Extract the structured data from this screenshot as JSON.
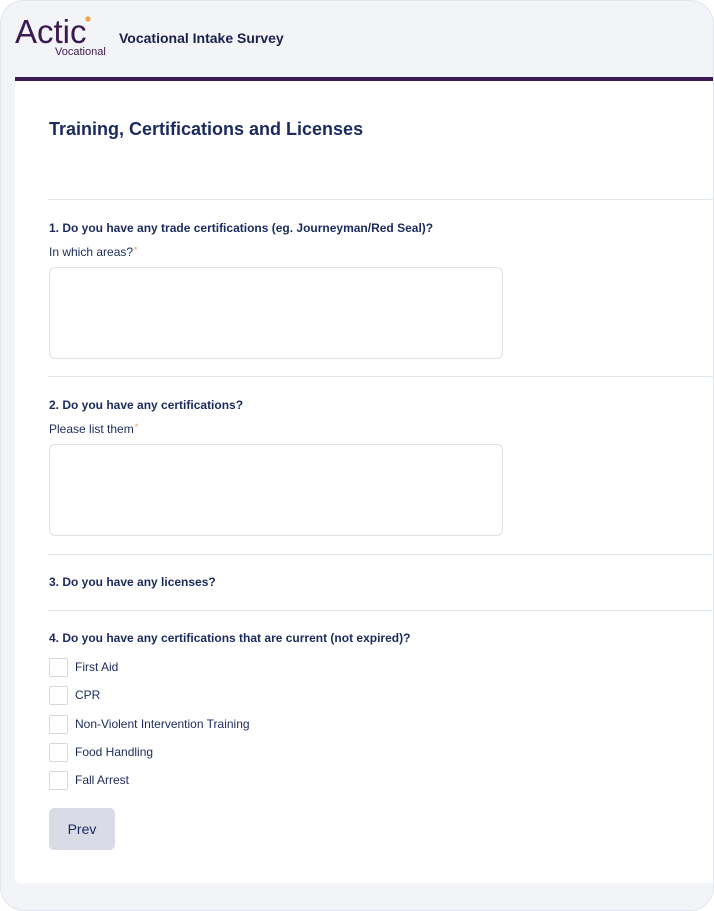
{
  "header": {
    "logo_text": "Actic",
    "logo_subtext": "Vocational",
    "title": "Vocational Intake Survey"
  },
  "colors": {
    "brand": "#3b1a50",
    "accent_dot": "#f0a44a",
    "text": "#1b2a5e"
  },
  "section": {
    "title": "Training, Certifications and Licenses"
  },
  "questions": [
    {
      "title": "1. Do you have any trade certifications (eg. Journeyman/Red Seal)?",
      "sub": "In which areas?",
      "required": "*",
      "value": ""
    },
    {
      "title": "2. Do you have any certifications?",
      "sub": "Please list them",
      "required": "*",
      "value": ""
    },
    {
      "title": "3. Do you have any licenses?"
    },
    {
      "title": "4. Do you have any certifications that are current (not expired)?",
      "options": [
        "First Aid",
        "CPR",
        "Non-Violent Intervention Training",
        "Food Handling",
        "Fall Arrest"
      ]
    }
  ],
  "buttons": {
    "prev_label": "Prev"
  }
}
